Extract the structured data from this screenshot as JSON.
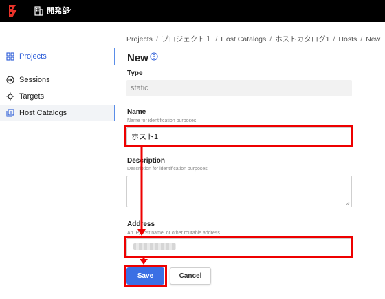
{
  "topbar": {
    "org_name": "開発部",
    "logo_icon": "boundary-logo",
    "org_icon": "building-icon"
  },
  "sidebar": {
    "items": [
      {
        "label": "Projects",
        "icon": "grid-icon"
      },
      {
        "label": "Sessions",
        "icon": "sessions-icon"
      },
      {
        "label": "Targets",
        "icon": "target-icon"
      },
      {
        "label": "Host Catalogs",
        "icon": "host-catalog-icon"
      }
    ]
  },
  "breadcrumb": [
    "Projects",
    "プロジェクト１",
    "Host Catalogs",
    "ホストカタログ1",
    "Hosts",
    "New"
  ],
  "breadcrumb_sep": "/",
  "page": {
    "title": "New"
  },
  "form": {
    "type": {
      "label": "Type",
      "value": "static"
    },
    "name": {
      "label": "Name",
      "hint": "Name for identification purposes",
      "value": "ホスト1"
    },
    "description": {
      "label": "Description",
      "hint": "Description for identification purposes",
      "value": ""
    },
    "address": {
      "label": "Address",
      "hint": "An IP, host name, or other routable address",
      "value": ""
    }
  },
  "buttons": {
    "save": "Save",
    "cancel": "Cancel"
  },
  "colors": {
    "accent": "#3b6fe4",
    "highlight": "#e00000",
    "topbar": "#000000"
  }
}
